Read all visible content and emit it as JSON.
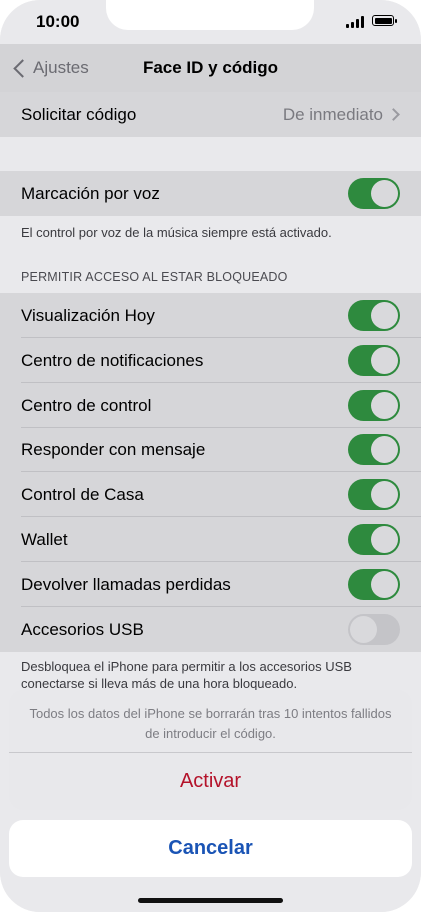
{
  "status_bar": {
    "time": "10:00"
  },
  "nav": {
    "back_label": "Ajustes",
    "title": "Face ID y código"
  },
  "solicitar": {
    "label": "Solicitar código",
    "value": "De inmediato"
  },
  "voice": {
    "label": "Marcación por voz",
    "toggle_on": true,
    "footnote": "El control por voz de la música siempre está activado."
  },
  "locked_access": {
    "header": "PERMITIR ACCESO AL ESTAR BLOQUEADO",
    "items": [
      {
        "label": "Visualización Hoy",
        "on": true
      },
      {
        "label": "Centro de notificaciones",
        "on": true
      },
      {
        "label": "Centro de control",
        "on": true
      },
      {
        "label": "Responder con mensaje",
        "on": true
      },
      {
        "label": "Control de Casa",
        "on": true
      },
      {
        "label": "Wallet",
        "on": true
      },
      {
        "label": "Devolver llamadas perdidas",
        "on": true
      },
      {
        "label": "Accesorios USB",
        "on": false
      }
    ],
    "footnote": "Desbloquea el iPhone para permitir a los accesorios USB conectarse si lleva más de una hora bloqueado."
  },
  "action_sheet": {
    "message": "Todos los datos del iPhone se borrarán tras 10 intentos fallidos de introducir el código.",
    "action_label": "Activar",
    "cancel_label": "Cancelar"
  },
  "colors": {
    "toggle_on": "#2e8a3e",
    "destructive": "#b4122a",
    "accent": "#1a54b5"
  }
}
